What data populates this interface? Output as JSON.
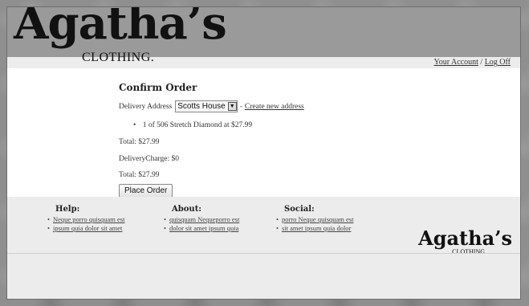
{
  "header": {
    "logo_main": "Agatha’s",
    "logo_sub": "CLOTHING.",
    "your_account": "Your Account",
    "separator": "/",
    "log_off": "Log Off"
  },
  "order": {
    "title": "Confirm Order",
    "delivery_label": "Delivery Address",
    "selected_address": "Scotts House",
    "dash": "-",
    "create_new": "Create new address",
    "item_bullet": "•",
    "item_text": "1 of 506 Stretch Diamond at $27.99",
    "total_first": "Total: $27.99",
    "delivery_charge": "DeliveryCharge: $0",
    "total_second": "Total: $27.99",
    "place_order": "Place Order"
  },
  "footer": {
    "help": {
      "title": "Help:",
      "links": [
        "Neque porro quisquam est",
        "ipsum quia dolor sit amet"
      ]
    },
    "about": {
      "title": "About:",
      "links": [
        "quisquam Nequeporro est",
        "dolor sit amet ipsum quia"
      ]
    },
    "social": {
      "title": "Social:",
      "links": [
        "porro Neque quisquam est",
        "sit amet ipsum quia dolor"
      ]
    },
    "logo_main": "Agatha’s",
    "logo_sub": "CLOTHING."
  },
  "icons": {
    "dropdown": "chevron-down-icon"
  }
}
